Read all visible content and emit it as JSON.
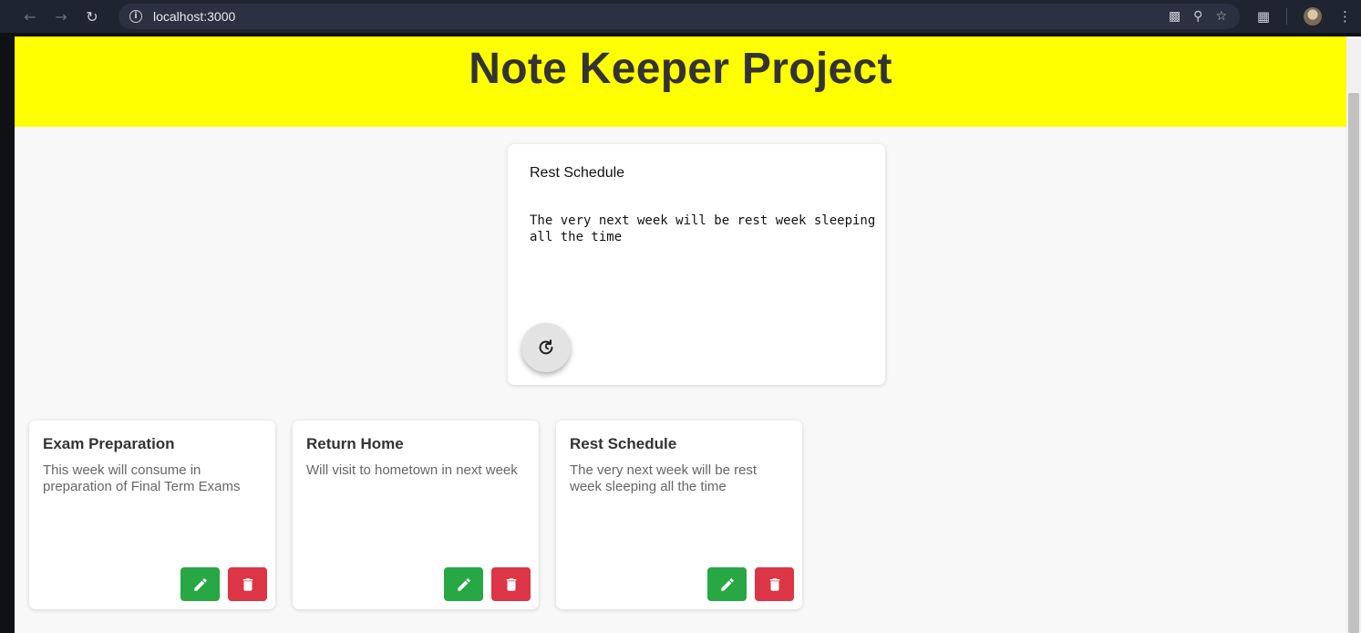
{
  "browser": {
    "url": "localhost:3000"
  },
  "header": {
    "title": "Note Keeper Project"
  },
  "editor": {
    "title": "Rest Schedule",
    "content": "The very next week will be rest week sleeping all the time"
  },
  "notes": [
    {
      "title": "Exam Preparation",
      "content": "This week will consume in preparation of Final Term Exams"
    },
    {
      "title": "Return Home",
      "content": "Will visit to hometown in next week"
    },
    {
      "title": "Rest Schedule",
      "content": "The very next week will be rest week sleeping all the time"
    }
  ],
  "colors": {
    "header_bg": "#ffff00",
    "edit_button": "#28a745",
    "delete_button": "#dc3545"
  },
  "icons": {
    "fab": "update-icon",
    "edit": "pencil-icon",
    "delete": "trash-icon"
  }
}
